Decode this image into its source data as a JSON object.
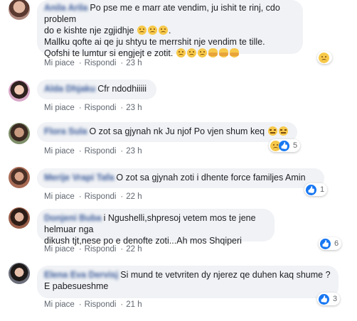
{
  "actions": {
    "like": "Mi piace",
    "reply": "Rispondi",
    "sep": "·"
  },
  "comments": [
    {
      "author": "Anila Arila",
      "text_lines": [
        "Po pse me e marr ate vendim, ju ishit te rinj, cdo problem",
        "do e kishte nje zgjidhje",
        "Mallku qofte ai qe ju shtyu te merrshit nje vendim te tille.",
        "Qofshi te lumtur si engjejt e zotit."
      ],
      "time": "23 h",
      "reaction_count": ""
    },
    {
      "author": "Alda Dhjaku",
      "text_lines": [
        "Cfr ndodhiiiii"
      ],
      "time": "23 h",
      "reaction_count": ""
    },
    {
      "author": "Flora Sula",
      "text_lines": [
        "O zot sa gjynah nk Ju njof Po vjen shum keq"
      ],
      "time": "23 h",
      "reaction_count": "5"
    },
    {
      "author": "Merije Vrapi Tafa",
      "text_lines": [
        "O zot sa gjynah zoti i dhente force familjes Amin"
      ],
      "time": "22 h",
      "reaction_count": "1"
    },
    {
      "author": "Donjeni Buba",
      "text_lines": [
        "i Ngushelli,shpresoj vetem mos te jene helmuar nga",
        "dikush tjt,nese po e denofte zoti...Ah mos Shqiperi"
      ],
      "time": "22 h",
      "reaction_count": "6"
    },
    {
      "author": "Elena Eva Dervisj",
      "text_lines": [
        "Si mund te vetvriten dy njerez qe duhen kaq shume ?",
        "E pabesueshme"
      ],
      "time": "21 h",
      "reaction_count": "3"
    }
  ]
}
